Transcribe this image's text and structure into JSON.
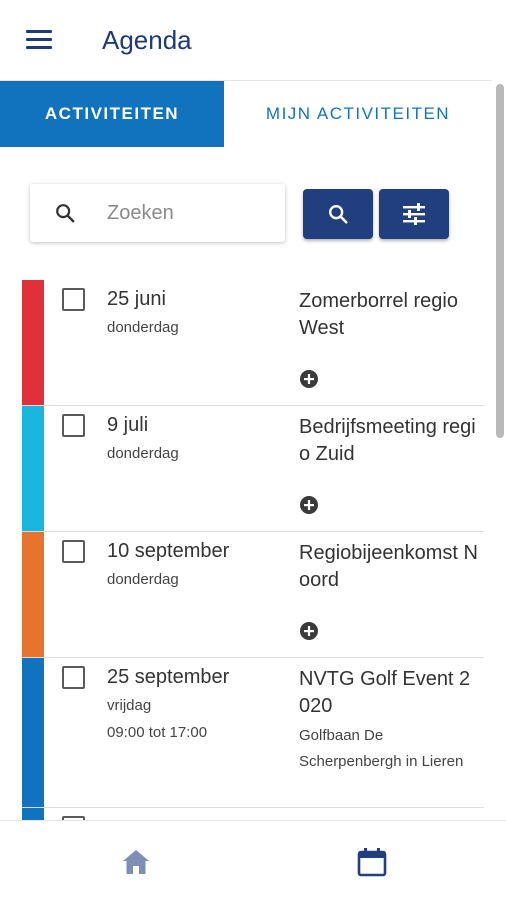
{
  "app": {
    "title": "Agenda"
  },
  "tabs": [
    {
      "label": "ACTIVITEITEN",
      "active": true
    },
    {
      "label": "MIJN ACTIVITEITEN",
      "active": false
    }
  ],
  "search": {
    "placeholder": "Zoeken",
    "value": ""
  },
  "colors": {
    "primary": "#213f7e",
    "tab_active": "#1173be"
  },
  "activities": [
    {
      "date": "25 juni",
      "weekday": "donderdag",
      "time": "",
      "title": "Zomerborrel regio West",
      "location": "",
      "color": "#e0313a",
      "checked": false
    },
    {
      "date": "9 juli",
      "weekday": "donderdag",
      "time": "",
      "title": "Bedrijfsmeeting regio Zuid",
      "location": "",
      "color": "#1ab6e0",
      "checked": false
    },
    {
      "date": "10 september",
      "weekday": "donderdag",
      "time": "",
      "title": "Regiobijeenkomst Noord",
      "location": "",
      "color": "#e8732e",
      "checked": false
    },
    {
      "date": "25 september",
      "weekday": "vrijdag",
      "time": "09:00 tot 17:00",
      "title": "NVTG Golf Event 2020",
      "location": "Golfbaan De Scherpenbergh in Lieren",
      "color": "#1173be",
      "checked": false
    }
  ],
  "bottom_nav": [
    {
      "icon": "home-icon",
      "active": false
    },
    {
      "icon": "calendar-icon",
      "active": true
    }
  ]
}
